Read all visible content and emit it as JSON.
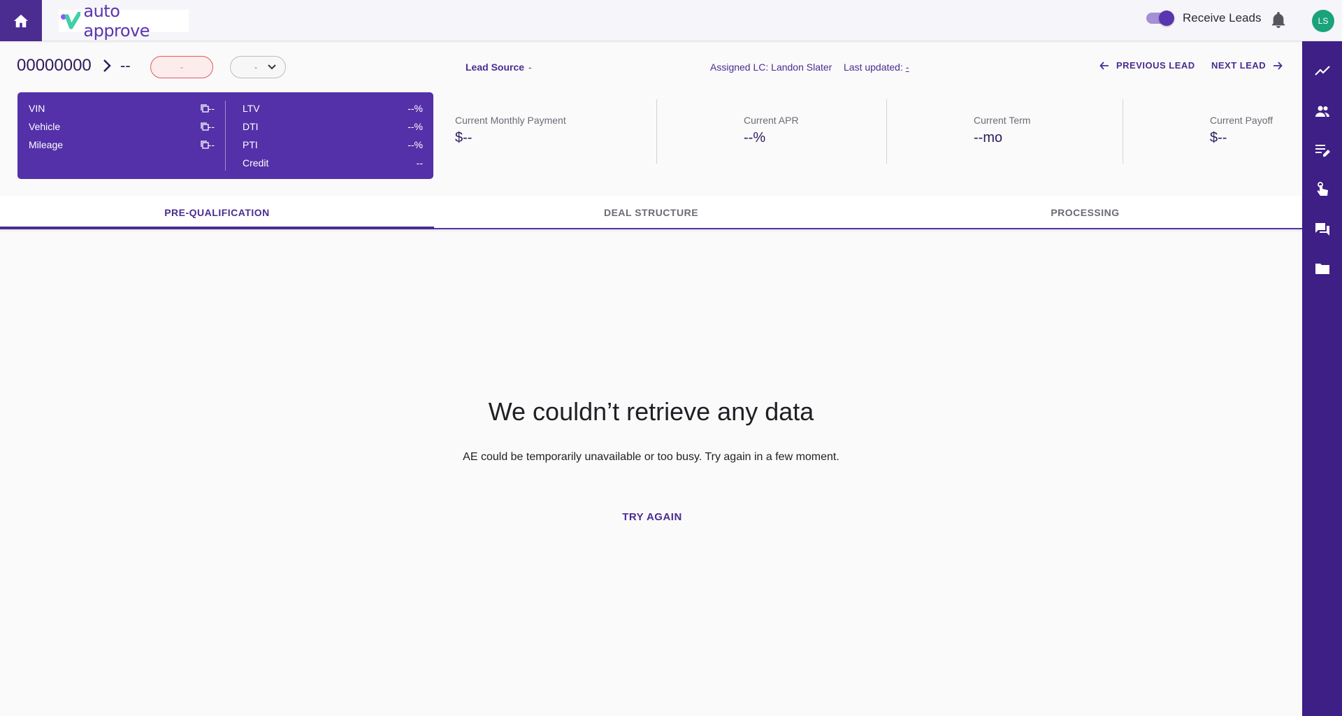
{
  "app": {
    "logo_text": "auto approve",
    "home_icon": "home-icon"
  },
  "topbar": {
    "receive_leads_label": "Receive Leads",
    "receive_leads_on": true,
    "avatar_initials": "LS",
    "accent": "#4b2c91",
    "avatar_color": "#1aa37a"
  },
  "lead": {
    "id": "00000000",
    "name": "--",
    "status": "-",
    "select_value": "-",
    "lead_source_label": "Lead Source",
    "lead_source_value": "-",
    "assigned": "Assigned LC: Landon Slater",
    "last_updated_label": "Last updated:",
    "last_updated_value": "-",
    "previous_label": "PREVIOUS LEAD",
    "next_label": "NEXT LEAD"
  },
  "card": {
    "left": [
      {
        "label": "VIN",
        "value": "--"
      },
      {
        "label": "Vehicle",
        "value": "--"
      },
      {
        "label": "Mileage",
        "value": "--"
      }
    ],
    "right": [
      {
        "label": "LTV",
        "value": "--%"
      },
      {
        "label": "DTI",
        "value": "--%"
      },
      {
        "label": "PTI",
        "value": "--%"
      },
      {
        "label": "Credit",
        "value": "--"
      }
    ]
  },
  "metrics": [
    {
      "label": "Current Monthly Payment",
      "value": "$--"
    },
    {
      "label": "Current APR",
      "value": "--%"
    },
    {
      "label": "Current Term",
      "value": "--mo"
    },
    {
      "label": "Current Payoff",
      "value": "$--"
    }
  ],
  "tabs": [
    {
      "label": "PRE-QUALIFICATION",
      "active": true
    },
    {
      "label": "DEAL STRUCTURE",
      "active": false
    },
    {
      "label": "PROCESSING",
      "active": false
    }
  ],
  "empty_state": {
    "title": "We couldn’t retrieve any data",
    "subtitle": "AE could be temporarily unavailable or too busy. Try again in a few moment.",
    "action": "TRY AGAIN"
  },
  "sidebar_icons": [
    "trend-icon",
    "people-icon",
    "edit-list-icon",
    "hand-pointer-icon",
    "chat-icon",
    "folder-icon"
  ]
}
